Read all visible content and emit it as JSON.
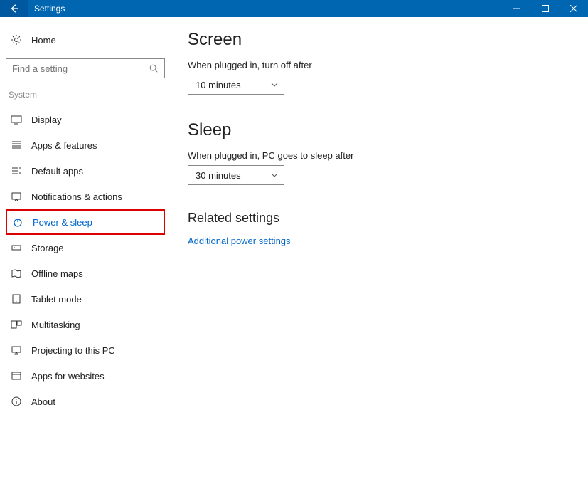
{
  "titlebar": {
    "title": "Settings"
  },
  "sidebar": {
    "home": "Home",
    "search_placeholder": "Find a setting",
    "category": "System",
    "items": [
      {
        "label": "Display",
        "icon": "display"
      },
      {
        "label": "Apps & features",
        "icon": "apps"
      },
      {
        "label": "Default apps",
        "icon": "defaults"
      },
      {
        "label": "Notifications & actions",
        "icon": "notifications"
      },
      {
        "label": "Power & sleep",
        "icon": "power"
      },
      {
        "label": "Storage",
        "icon": "storage"
      },
      {
        "label": "Offline maps",
        "icon": "maps"
      },
      {
        "label": "Tablet mode",
        "icon": "tablet"
      },
      {
        "label": "Multitasking",
        "icon": "multitask"
      },
      {
        "label": "Projecting to this PC",
        "icon": "project"
      },
      {
        "label": "Apps for websites",
        "icon": "websites"
      },
      {
        "label": "About",
        "icon": "about"
      }
    ],
    "selected_index": 4
  },
  "main": {
    "screen": {
      "heading": "Screen",
      "label": "When plugged in, turn off after",
      "value": "10 minutes"
    },
    "sleep": {
      "heading": "Sleep",
      "label": "When plugged in, PC goes to sleep after",
      "value": "30 minutes"
    },
    "related": {
      "heading": "Related settings",
      "link": "Additional power settings"
    }
  }
}
